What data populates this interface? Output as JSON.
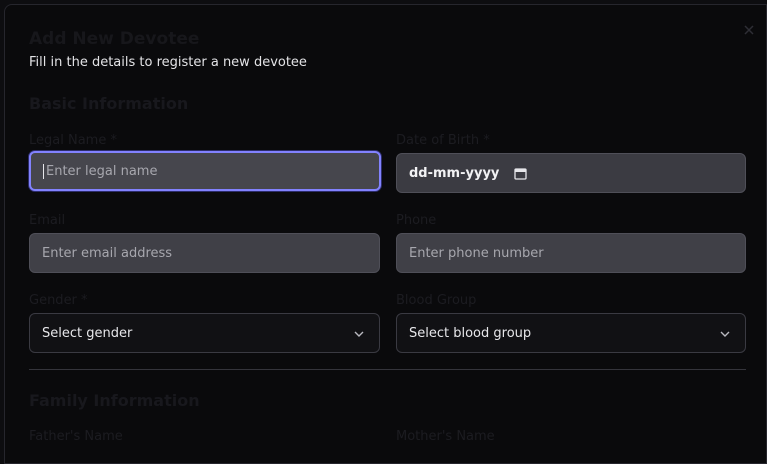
{
  "dialog": {
    "title": "Add New Devotee",
    "subtitle": "Fill in the details to register a new devotee",
    "close_icon": "close-icon"
  },
  "basic_info": {
    "heading": "Basic Information",
    "legal_name": {
      "label": "Legal Name *",
      "placeholder": "Enter legal name"
    },
    "dob": {
      "label": "Date of Birth *",
      "value": "dd-mm-yyyy",
      "icon": "calendar-icon"
    },
    "email": {
      "label": "Email",
      "placeholder": "Enter email address"
    },
    "phone": {
      "label": "Phone",
      "placeholder": "Enter phone number"
    },
    "gender": {
      "label": "Gender *",
      "selected": "Select gender",
      "icon": "chevron-down-icon"
    },
    "blood_group": {
      "label": "Blood Group",
      "selected": "Select blood group",
      "icon": "chevron-down-icon"
    }
  },
  "family_info": {
    "heading": "Family Information",
    "father_name": {
      "label": "Father's Name"
    },
    "mother_name": {
      "label": "Mother's Name"
    }
  },
  "colors": {
    "focus_ring": "#8282ff",
    "input_bg": "#404047",
    "modal_bg": "#0a0a0c"
  }
}
